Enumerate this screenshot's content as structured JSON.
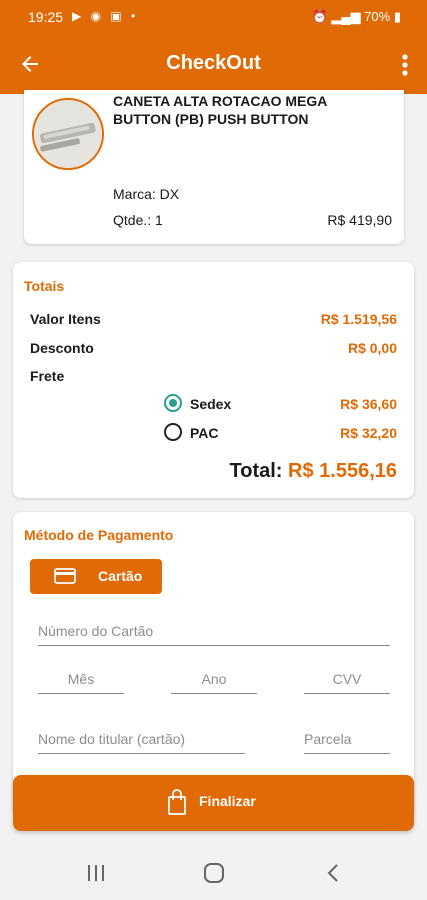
{
  "status_bar": {
    "time": "19:25",
    "battery": "70%"
  },
  "app_bar": {
    "title": "CheckOut",
    "back_icon": "arrow-left-icon",
    "menu_icon": "more-vert-icon"
  },
  "product": {
    "name": "CANETA ALTA ROTACAO MEGA BUTTON (PB) PUSH BUTTON",
    "brand": "Marca: DX",
    "quantity": "Qtde.: 1",
    "price": "R$ 419,90"
  },
  "totals": {
    "title": "Totais",
    "items_label": "Valor Itens",
    "items_value": "R$ 1.519,56",
    "discount_label": "Desconto",
    "discount_value": "R$ 0,00",
    "shipping_label": "Frete",
    "shipping_options": [
      {
        "label": "Sedex",
        "value": "R$ 36,60",
        "selected": true
      },
      {
        "label": "PAC",
        "value": "R$ 32,20",
        "selected": false
      }
    ],
    "total_label": "Total:",
    "total_value": "R$ 1.556,16"
  },
  "payment": {
    "title": "Método de Pagamento",
    "method_button": "Cartão",
    "card_number_placeholder": "Número do Cartão",
    "month_placeholder": "Mês",
    "year_placeholder": "Ano",
    "cvv_placeholder": "CVV",
    "holder_placeholder": "Nome do titular (cartão)",
    "installment_placeholder": "Parcela"
  },
  "finalize_button": "Finalizar",
  "colors": {
    "brand": "#e06a06",
    "radio_selected": "#2a9d8f"
  }
}
